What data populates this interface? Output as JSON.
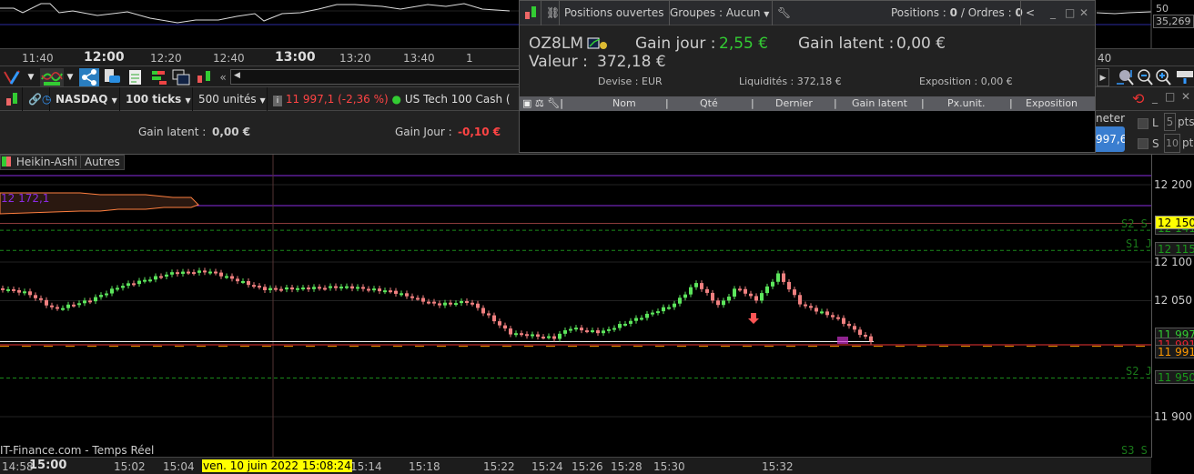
{
  "top_axis": {
    "labels": [
      {
        "t": "11:40",
        "b": false
      },
      {
        "t": "12:00",
        "b": true
      },
      {
        "t": "12:20",
        "b": false
      },
      {
        "t": "12:40",
        "b": false
      },
      {
        "t": "13:00",
        "b": true
      },
      {
        "t": "13:20",
        "b": false
      },
      {
        "t": "13:40",
        "b": false
      },
      {
        "t": "1",
        "b": false
      },
      {
        "t": "40",
        "b": false
      }
    ],
    "indicator_values": [
      "50",
      "35,269"
    ]
  },
  "symbol_bar": {
    "instrument": "NASDAQ",
    "ticks": "100 ticks",
    "units": "500 unités",
    "price": "11 997,1 (-2,36 %)",
    "name": "US Tech 100 Cash (",
    "price_color": "#ff4444"
  },
  "gain_bar": {
    "latent_label": "Gain latent :",
    "latent_value": "0,00 €",
    "jour_label": "Gain Jour :",
    "jour_value": "-0,10 €"
  },
  "chart_tabs": [
    "Heikin-Ashi",
    "Autres"
  ],
  "chart": {
    "hist_label": "12 172,1",
    "source": "IT-Finance.com - Temps Réel",
    "crosshair_date": "ven. 10 juin 2022 15:08:24",
    "levels": [
      {
        "name": "S2 S",
        "price": 12141
      },
      {
        "name": "S1 J",
        "price": 12115
      },
      {
        "name": "S2 J",
        "price": 11950
      },
      {
        "name": "S3 S",
        "price": 11860
      }
    ],
    "price_labels": [
      "12 200",
      "12 100",
      "12 050",
      "11 900"
    ],
    "boxes": {
      "current": "12 150",
      "s2s": "12 141,",
      "s1j": "12 115,",
      "p1": "11 997,",
      "p2": "11 991,",
      "p3": "11 991,",
      "s2j": "11 950,"
    },
    "key_prices": [
      [
        0,
        12066
      ],
      [
        30,
        12060
      ],
      [
        60,
        12039
      ],
      [
        100,
        12051
      ],
      [
        130,
        12068
      ],
      [
        190,
        12086
      ],
      [
        230,
        12088
      ],
      [
        290,
        12065
      ],
      [
        330,
        12066
      ],
      [
        380,
        12068
      ],
      [
        430,
        12062
      ],
      [
        480,
        12045
      ],
      [
        515,
        12049
      ],
      [
        540,
        12027
      ],
      [
        560,
        12008
      ],
      [
        610,
        12002
      ],
      [
        625,
        12015
      ],
      [
        660,
        12009
      ],
      [
        700,
        12027
      ],
      [
        740,
        12045
      ],
      [
        765,
        12073
      ],
      [
        790,
        12043
      ],
      [
        810,
        12068
      ],
      [
        830,
        12050
      ],
      [
        855,
        12084
      ],
      [
        880,
        12045
      ],
      [
        920,
        12027
      ],
      [
        958,
        11997
      ]
    ]
  },
  "bottom_axis": [
    "14:58",
    "15:00",
    "15:02",
    "15:04",
    "15:14",
    "15:18",
    "15:22",
    "15:24",
    "15:26",
    "15:28",
    "15:30",
    "15:32"
  ],
  "positions_window": {
    "title": "Positions ouvertes",
    "groups": "Groupes : Aucun",
    "positions_label": "Positions :",
    "positions": "0",
    "orders_label": "/ Ordres :",
    "orders": "0",
    "account": "OZ8LM",
    "gain_jour_label": "Gain jour :",
    "gain_jour": "2,55 €",
    "gain_latent_label": "Gain latent :",
    "gain_latent": "0,00 €",
    "valeur_label": "Valeur :",
    "valeur": "372,18 €",
    "devise": "Devise : EUR",
    "liquidites": "Liquidités : 372,18 €",
    "exposition": "Exposition : 0,00 €",
    "columns": [
      "Nom",
      "Qté",
      "Dernier",
      "Gain latent",
      "Px.unit.",
      "Exposition"
    ]
  },
  "right_panel": {
    "meter": "neter",
    "button": "997,6",
    "L": "L",
    "L_pts": "5",
    "S": "S",
    "S_pts": "10",
    "pts": "pts"
  }
}
